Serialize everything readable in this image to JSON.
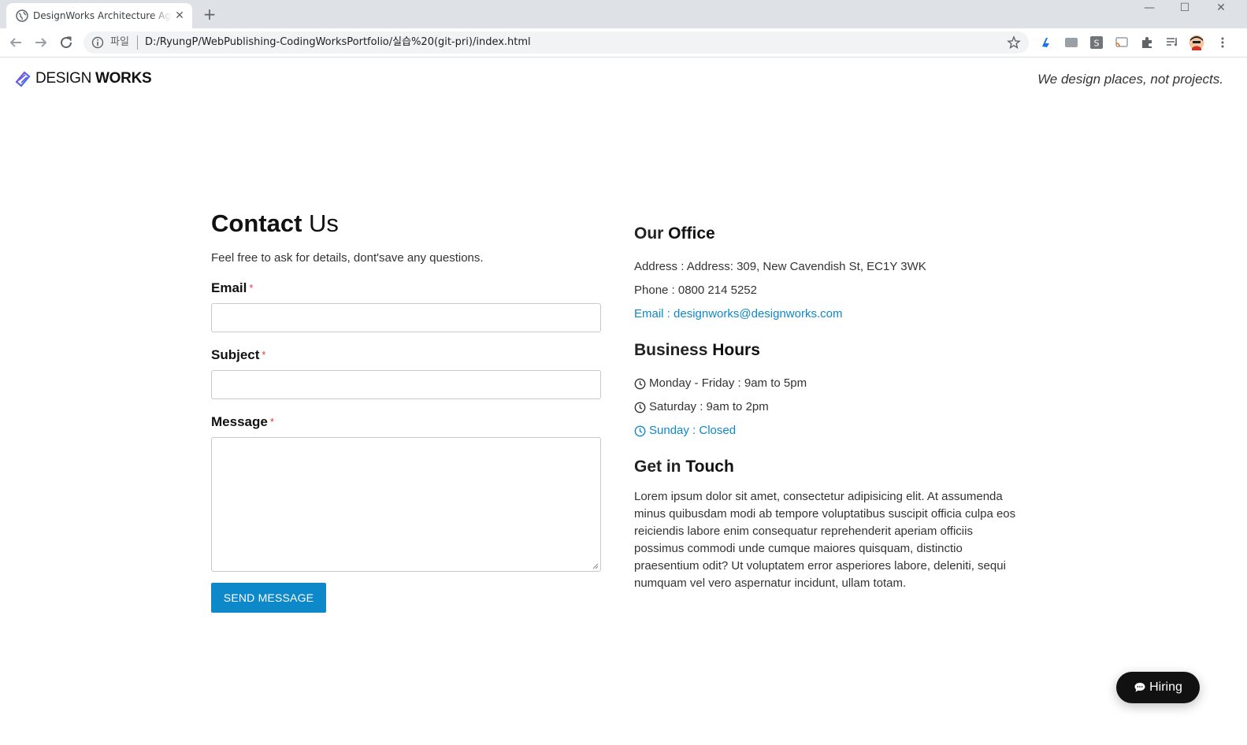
{
  "browser": {
    "tab_title": "DesignWorks Architecture Agency",
    "tab_close": "✕",
    "new_tab": "+",
    "url_scheme": "파일",
    "url": "D:/RyungP/WebPublishing-CodingWorksPortfolio/실습%20(git-pri)/index.html",
    "window_minimize": "—",
    "window_maximize": "☐",
    "window_close": "✕"
  },
  "site": {
    "logo_light": "DESIGN ",
    "logo_bold": "WORKS",
    "tagline": "We design places, not projects."
  },
  "contact": {
    "title_bold": "Contact",
    "title_light": " Us",
    "description": "Feel free to ask for details, dont'save any questions.",
    "email_label": "Email",
    "subject_label": "Subject",
    "message_label": "Message",
    "required_mark": "*",
    "email_value": "",
    "subject_value": "",
    "message_value": "",
    "send_label": "SEND MESSAGE"
  },
  "office": {
    "heading_light": "Our ",
    "heading_bold": "Office",
    "address": "Address : Address: 309, New Cavendish St, EC1Y 3WK",
    "phone": "Phone : 0800 214 5252",
    "email": "Email : designworks@designworks.com"
  },
  "hours": {
    "heading_light": "Business ",
    "heading_bold": "Hours",
    "weekdays": "Monday - Friday : 9am to 5pm",
    "saturday": "Saturday : 9am to 2pm",
    "sunday": "Sunday : Closed"
  },
  "touch": {
    "heading_light": "Get in ",
    "heading_bold": "Touch",
    "body": "Lorem ipsum dolor sit amet, consectetur adipisicing elit. At assumenda minus quibusdam modi ab tempore voluptatibus suscipit officia culpa eos reiciendis labore enim consequatur reprehenderit aperiam officiis possimus commodi unde cumque maiores quisquam, distinctio praesentium odit? Ut voluptatem error asperiores labore, deleniti, sequi numquam vel vero aspernatur incidunt, ullam totam."
  },
  "hiring_label": "Hiring",
  "colors": {
    "accent": "#0d88c9",
    "required": "#e53935",
    "hiring_bg": "#111111"
  }
}
